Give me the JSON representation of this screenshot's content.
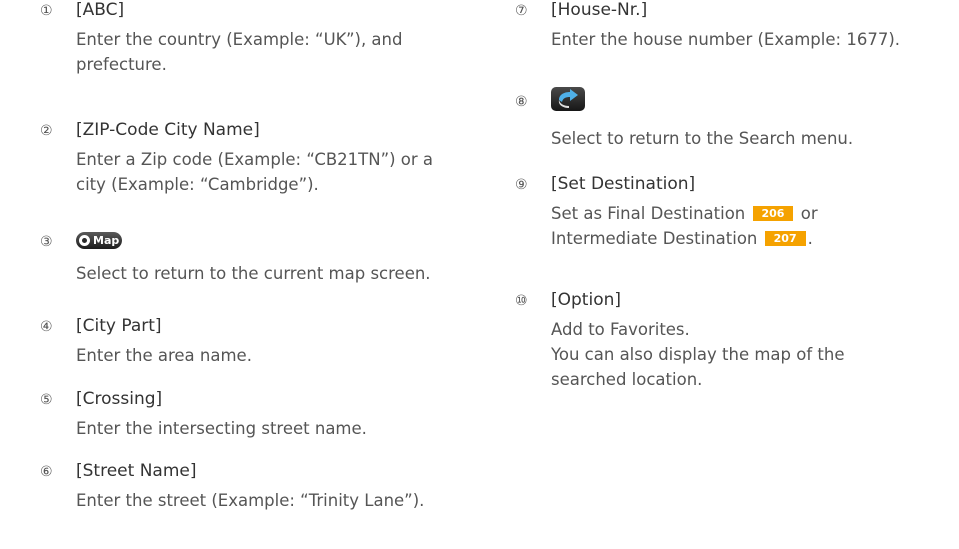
{
  "items": [
    {
      "num": "①",
      "title": "[ABC]",
      "lines": [
        "Enter the country (Example: “UK”), and",
        "prefecture."
      ]
    },
    {
      "num": "②",
      "title": "[ZIP-Code City Name]",
      "lines": [
        "Enter a Zip code (Example: “CB21TN”) or a",
        "city (Example: “Cambridge”)."
      ]
    },
    {
      "num": "③",
      "icon": "map-button-icon",
      "icon_label": "Map",
      "lines": [
        "Select to return to the current map screen."
      ]
    },
    {
      "num": "④",
      "title": "[City Part]",
      "lines": [
        "Enter the area name."
      ]
    },
    {
      "num": "⑤",
      "title": "[Crossing]",
      "lines": [
        "Enter the intersecting street name."
      ]
    },
    {
      "num": "⑥",
      "title": "[Street Name]",
      "lines": [
        "Enter the street (Example: “Trinity Lane”)."
      ]
    },
    {
      "num": "⑦",
      "title": "[House-Nr.]",
      "lines": [
        "Enter the house number (Example: 1677)."
      ]
    },
    {
      "num": "⑧",
      "icon": "back-arrow-icon",
      "lines": [
        "Select to return to the Search menu."
      ]
    },
    {
      "num": "⑨",
      "title": "[Set Destination]",
      "line1_text": "Set as Final Destination",
      "line1_ref": "206",
      "line1_after": "or",
      "line2_text": "Intermediate Destination",
      "line2_ref": "207",
      "line2_after": "."
    },
    {
      "num": "⑩",
      "title": "[Option]",
      "lines": [
        "Add to Favorites.",
        "You can also display the map of the",
        "searched location."
      ]
    }
  ],
  "colors": {
    "page_ref_bg": "#f5a200",
    "text": "#555555"
  }
}
